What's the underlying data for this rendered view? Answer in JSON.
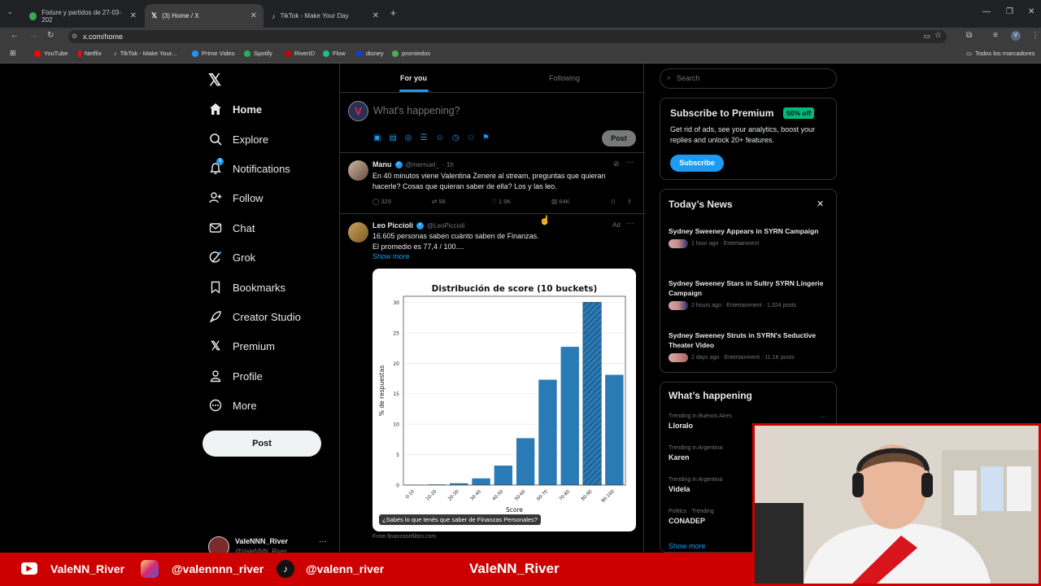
{
  "browser": {
    "tabs": [
      {
        "label": "Fixture y partidos de 27-03-202",
        "color": "#34a853"
      },
      {
        "label": "(3) Home / X",
        "color": "#ffffff"
      },
      {
        "label": "TikTok - Make Your Day",
        "color": "#ffffff"
      }
    ],
    "url": "x.com/home",
    "bookmarks": [
      {
        "label": "YouTube",
        "color": "#ff0000"
      },
      {
        "label": "Netflix",
        "color": "#e50914"
      },
      {
        "label": "TikTok - Make Your...",
        "color": "#ffffff"
      },
      {
        "label": "Prime Video",
        "color": "#1a98ff"
      },
      {
        "label": "Spotify",
        "color": "#1db954"
      },
      {
        "label": "RiverID",
        "color": "#c00"
      },
      {
        "label": "Flow",
        "color": "#18c47a"
      },
      {
        "label": "disney",
        "color": "#113ccf"
      },
      {
        "label": "promiedos",
        "color": "#4caf50"
      }
    ],
    "all_bookmarks": "Todos los marcadores"
  },
  "nav": {
    "items": [
      {
        "label": "Home",
        "icon": "home-icon"
      },
      {
        "label": "Explore",
        "icon": "search-icon"
      },
      {
        "label": "Notifications",
        "icon": "bell-icon"
      },
      {
        "label": "Follow",
        "icon": "follow-icon"
      },
      {
        "label": "Chat",
        "icon": "mail-icon"
      },
      {
        "label": "Grok",
        "icon": "grok-icon"
      },
      {
        "label": "Bookmarks",
        "icon": "bookmark-icon"
      },
      {
        "label": "Creator Studio",
        "icon": "rocket-icon"
      },
      {
        "label": "Premium",
        "icon": "x-icon"
      },
      {
        "label": "Profile",
        "icon": "person-icon"
      },
      {
        "label": "More",
        "icon": "more-icon"
      }
    ],
    "post_label": "Post",
    "notif_count": "3",
    "account_name": "ValeNNN_River",
    "account_handle": "@ValeNNN_River"
  },
  "feed": {
    "tab_for_you": "For you",
    "tab_following": "Following",
    "compose_placeholder": "What's happening?",
    "compose_post": "Post",
    "tweet1": {
      "name": "Manu",
      "handle": "@mernuel_",
      "time": "· 1h",
      "text": "En 40 minutos viene Valentina Zenere al stream, preguntas que quieran hacerle? Cosas que quieran saber de ella? Los y las leo.",
      "replies": "329",
      "reposts": "58",
      "likes": "1.9K",
      "views": "64K"
    },
    "tweet2": {
      "name": "Leo Piccioli",
      "handle": "@LeoPiccioli",
      "ad": "Ad",
      "text1": "16.605 personas saben cuánto saben de Finanzas.",
      "text2": "El promedio es 77,4 / 100....",
      "show_more": "Show more",
      "caption": "¿Sabés lo que tenés que saber de Finanzas Personales?",
      "source": "From finanzasellibro.com"
    }
  },
  "chart_data": {
    "type": "bar",
    "title": "Distribución de score (10 buckets)",
    "xlabel": "Score",
    "ylabel": "% de respuestas",
    "categories": [
      "0-10",
      "10-20",
      "20-30",
      "30-40",
      "40-50",
      "50-60",
      "60-70",
      "70-80",
      "80-90",
      "90-100"
    ],
    "values": [
      0.05,
      0.1,
      0.3,
      1.1,
      3.2,
      7.7,
      17.3,
      22.7,
      30.0,
      18.1
    ],
    "highlighted": "80-90",
    "ylim": [
      0,
      31
    ],
    "yticks": [
      0,
      5,
      10,
      15,
      20,
      25,
      30
    ],
    "bar_color": "#2a7ab5",
    "grid": true
  },
  "right": {
    "search_placeholder": "Search",
    "premium": {
      "title": "Subscribe to Premium",
      "badge": "50% off",
      "text": "Get rid of ads, see your analytics, boost your replies and unlock 20+ features.",
      "button": "Subscribe"
    },
    "news": {
      "title": "Today’s News",
      "items": [
        {
          "title": "Sydney Sweeney Appears in SYRN Campaign",
          "meta": "1 hour ago · Entertainment ·"
        },
        {
          "title": "Sydney Sweeney Stars in Sultry SYRN Lingerie Campaign",
          "meta": "2 hours ago · Entertainment · 1,324 posts"
        },
        {
          "title": "Sydney Sweeney Struts in SYRN's Seductive Theater Video",
          "meta": "2 days ago · Entertainment · 11.1K posts"
        }
      ]
    },
    "happening": {
      "title": "What’s happening",
      "trends": [
        {
          "cat": "Trending in Buenos Aires",
          "name": "Lloralo"
        },
        {
          "cat": "Trending in Argentina",
          "name": "Karen"
        },
        {
          "cat": "Trending in Argentina",
          "name": "Videla"
        },
        {
          "cat": "Politics · Trending",
          "name": "CONADEP"
        }
      ],
      "show_more": "Show more"
    }
  },
  "overlay": {
    "youtube": "ValeNN_River",
    "instagram": "@valennnn_river",
    "tiktok": "@valenn_river",
    "center": "ValeNN_River"
  }
}
